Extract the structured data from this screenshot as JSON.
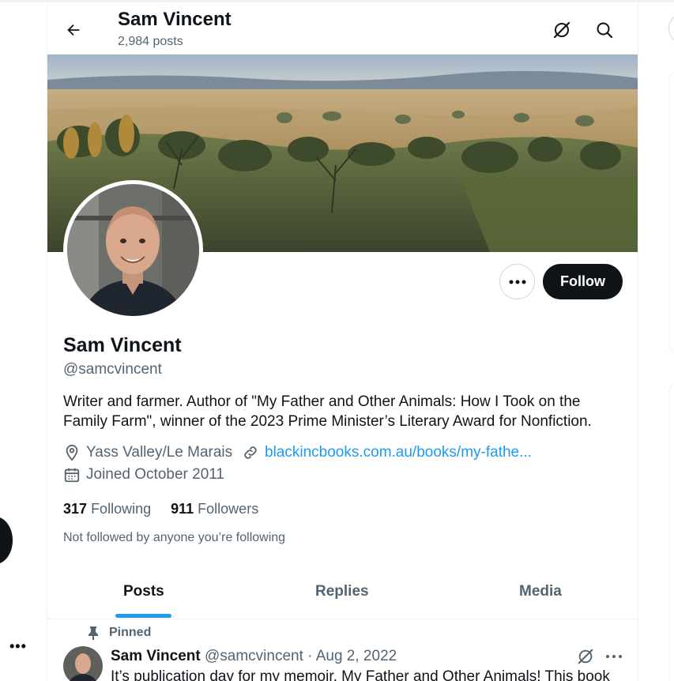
{
  "header": {
    "title": "Sam Vincent",
    "post_count": "2,984 posts"
  },
  "profile": {
    "name": "Sam Vincent",
    "handle": "@samcvincent",
    "bio": "Writer and farmer. Author of \"My Father and Other Animals: How I Took on the Family Farm\", winner of the 2023 Prime Minister’s Literary Award for Nonfiction.",
    "location": "Yass Valley/Le Marais",
    "link": "blackincbooks.com.au/books/my-fathe...",
    "joined": "Joined October 2011",
    "following_count": "317",
    "following_label": "Following",
    "followers_count": "911",
    "followers_label": "Followers",
    "not_followed_note": "Not followed by anyone you’re following",
    "follow_button": "Follow"
  },
  "tabs": [
    {
      "label": "Posts",
      "active": true
    },
    {
      "label": "Replies",
      "active": false
    },
    {
      "label": "Media",
      "active": false
    }
  ],
  "pinned_post": {
    "pinned_label": "Pinned",
    "author_name": "Sam Vincent",
    "author_handle": "@samcvincent",
    "separator": "·",
    "date": "Aug 2, 2022",
    "text": "It’s publication day for my memoir, My Father and Other Animals! This book"
  },
  "colors": {
    "accent": "#1d9bf0",
    "text_primary": "#0f1419",
    "text_secondary": "#536471",
    "button_dark": "#0f1419"
  },
  "icons": [
    "back-arrow-icon",
    "grok-icon",
    "search-icon",
    "more-icon",
    "location-icon",
    "link-icon",
    "calendar-icon",
    "pin-icon"
  ]
}
